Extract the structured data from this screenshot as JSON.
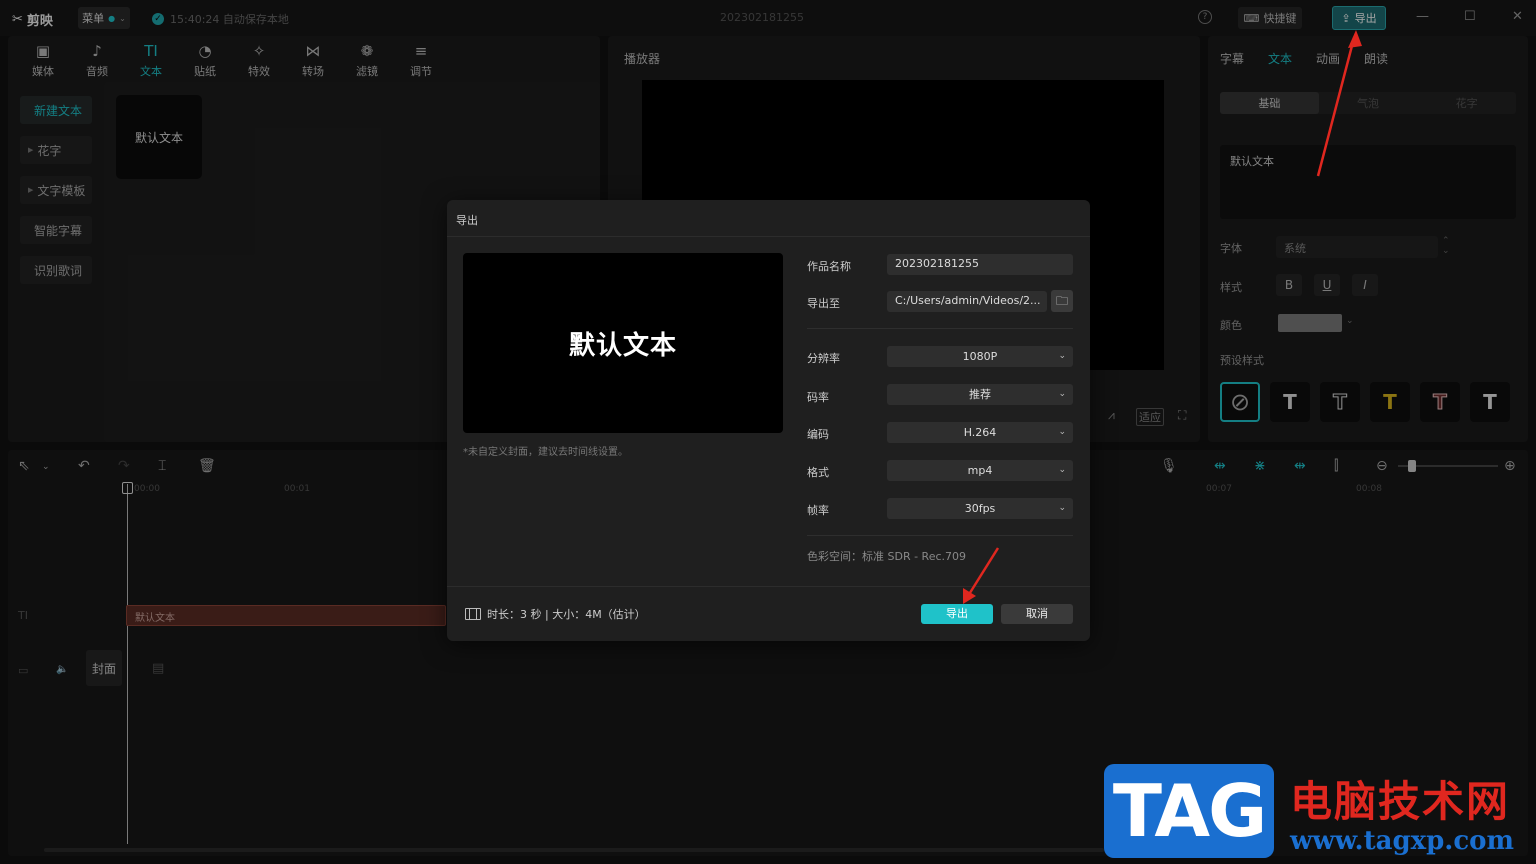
{
  "titlebar": {
    "logo": "剪映",
    "menu": "菜单",
    "autosave": "15:40:24 自动保存本地",
    "project_name": "202302181255",
    "shortcut": "快捷键",
    "export": "导出"
  },
  "tool_tabs": [
    {
      "label": "媒体",
      "icon": "▣"
    },
    {
      "label": "音频",
      "icon": "♪"
    },
    {
      "label": "文本",
      "icon": "TI"
    },
    {
      "label": "贴纸",
      "icon": "◔"
    },
    {
      "label": "特效",
      "icon": "✧"
    },
    {
      "label": "转场",
      "icon": "⋈"
    },
    {
      "label": "滤镜",
      "icon": "❁"
    },
    {
      "label": "调节",
      "icon": "≡"
    }
  ],
  "left_nav": [
    "新建文本",
    "花字",
    "文字模板",
    "智能字幕",
    "识别歌词"
  ],
  "text_thumb": "默认文本",
  "player": {
    "label": "播放器",
    "fit": "适应"
  },
  "right_panel": {
    "tabs": [
      "字幕",
      "文本",
      "动画",
      "朗读"
    ],
    "segments": [
      "基础",
      "气泡",
      "花字"
    ],
    "text_value": "默认文本",
    "font_label": "字体",
    "font_value": "系统",
    "style_label": "样式",
    "color_label": "颜色",
    "preset_label": "预设样式",
    "style_buttons": [
      "B",
      "U",
      "I"
    ]
  },
  "timeline": {
    "ticks": [
      "00:00",
      "00:01",
      "00:07",
      "00:08"
    ],
    "text_clip": "默认文本",
    "cover": "封面"
  },
  "dialog": {
    "title": "导出",
    "preview_text": "默认文本",
    "note": "*未自定义封面，建议去时间线设置。",
    "name_label": "作品名称",
    "name_value": "202302181255",
    "path_label": "导出至",
    "path_value": "C:/Users/admin/Videos/2...",
    "resolution_label": "分辨率",
    "resolution_value": "1080P",
    "bitrate_label": "码率",
    "bitrate_value": "推荐",
    "codec_label": "编码",
    "codec_value": "H.264",
    "format_label": "格式",
    "format_value": "mp4",
    "fps_label": "帧率",
    "fps_value": "30fps",
    "color_space": "色彩空间：标准 SDR - Rec.709",
    "footer_info": "时长：3 秒 | 大小：4M（估计）",
    "export_btn": "导出",
    "cancel_btn": "取消"
  },
  "watermark": {
    "tag": "TAG",
    "cn": "电脑技术网",
    "url": "www.tagxp.com"
  },
  "colors": {
    "accent": "#1fc2c9",
    "annotation": "#e0271f"
  }
}
